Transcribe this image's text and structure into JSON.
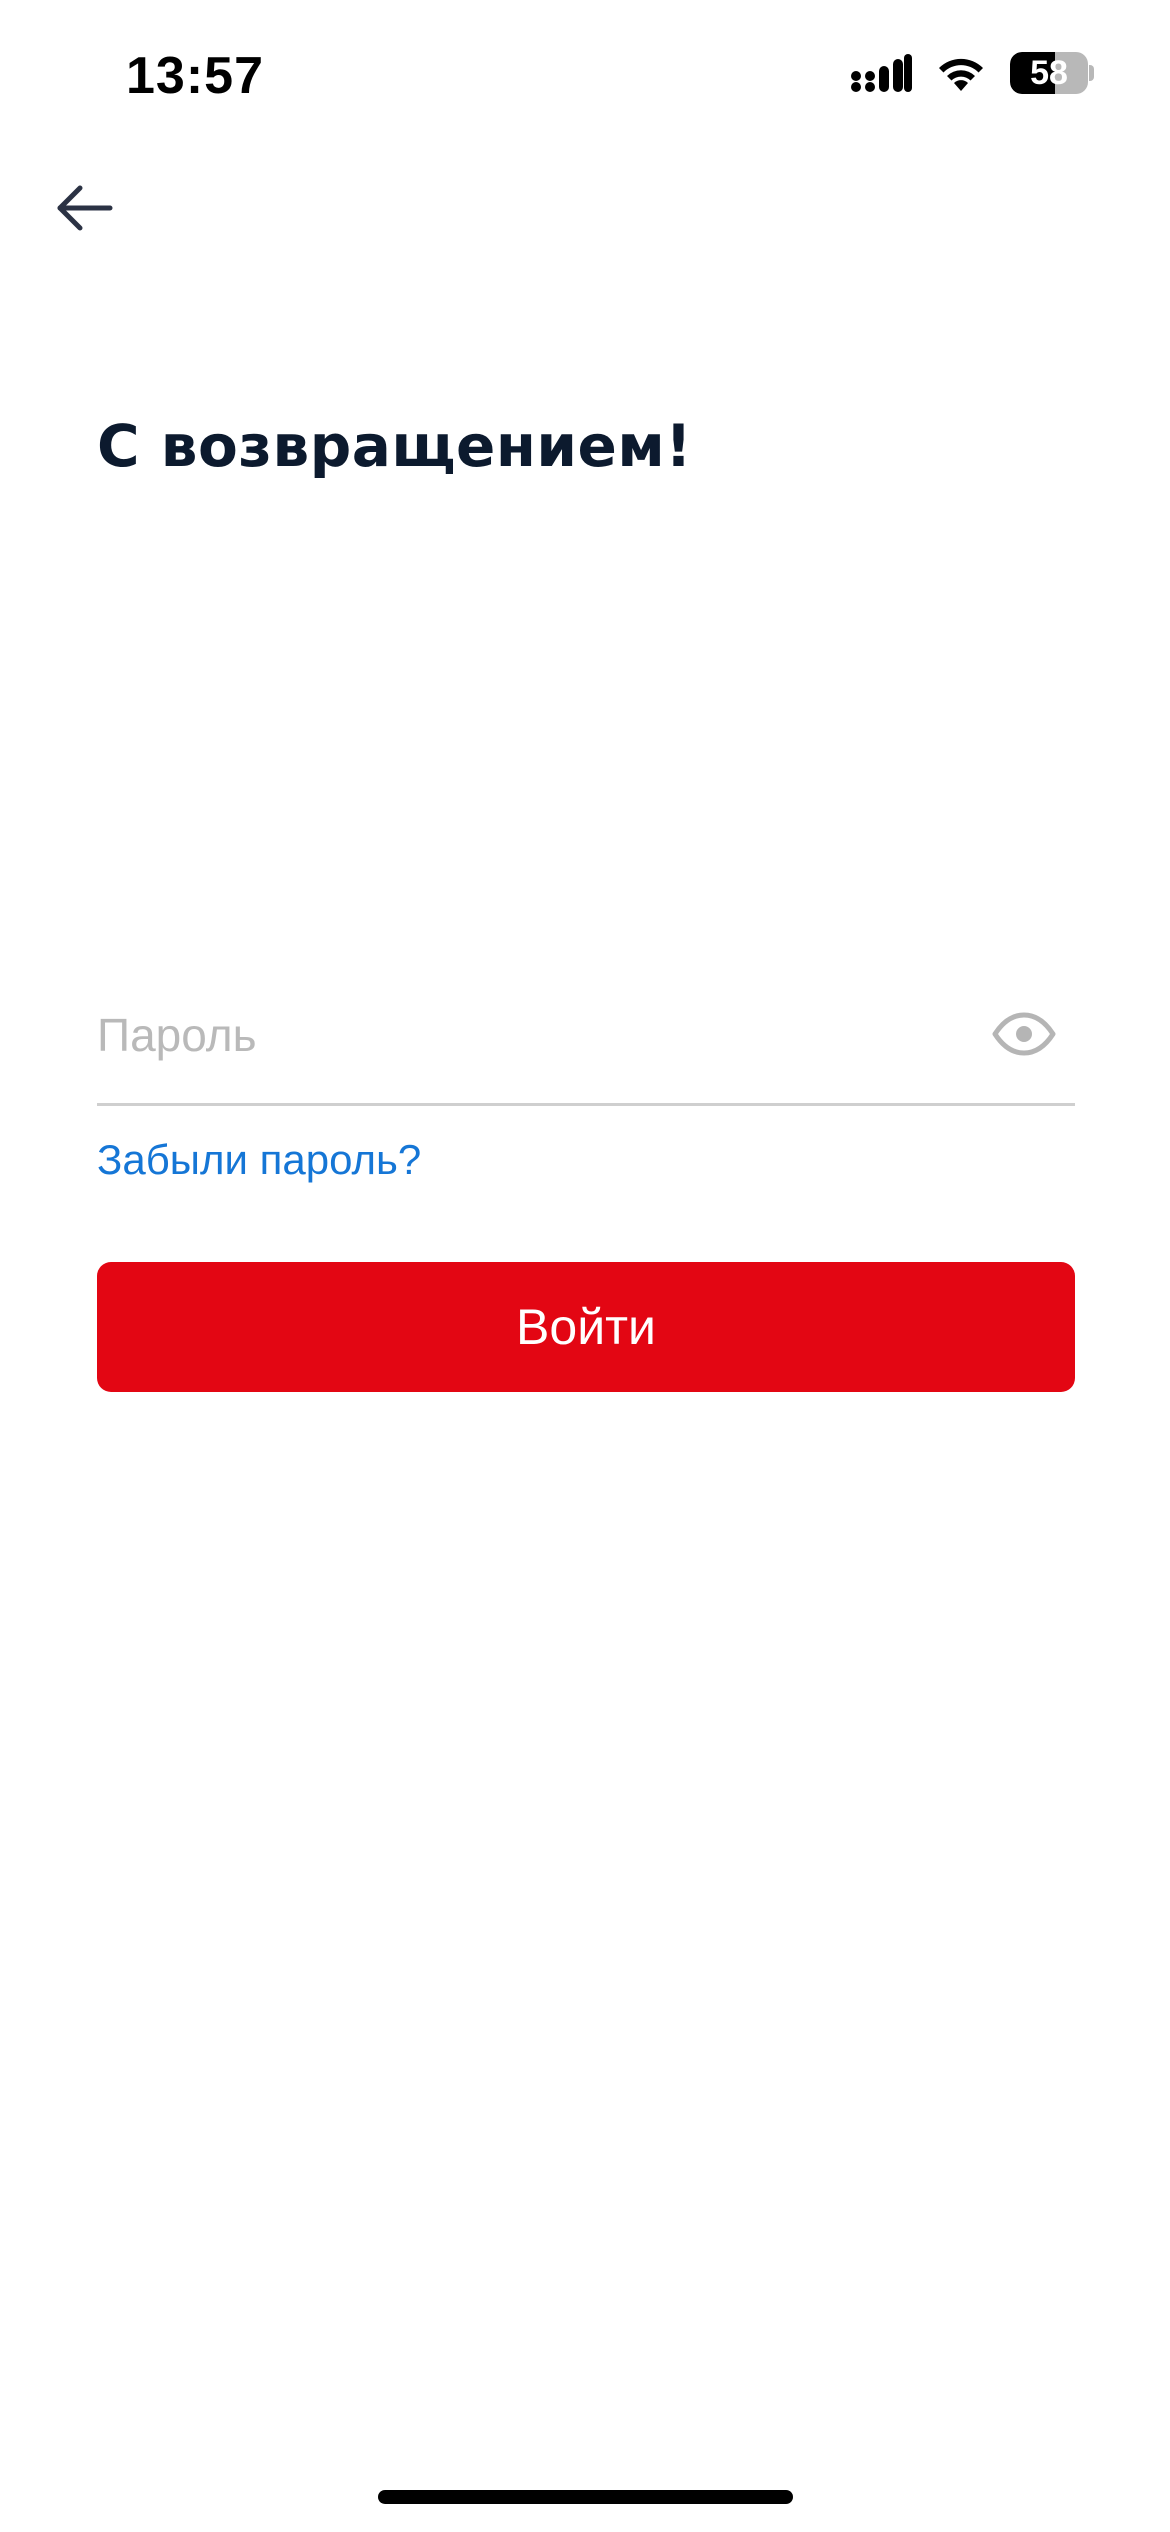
{
  "status_bar": {
    "time": "13:57",
    "battery_percent": "58",
    "battery_level": 0.58,
    "icons": [
      "signal-icon",
      "wifi-icon",
      "battery-icon"
    ]
  },
  "nav": {
    "back_icon": "arrow-left-icon"
  },
  "page": {
    "title": "С возвращением!"
  },
  "password_field": {
    "placeholder": "Пароль",
    "value": "",
    "toggle_icon": "eye-icon"
  },
  "forgot_password": {
    "label": "Забыли пароль?"
  },
  "login_button": {
    "label": "Войти"
  },
  "colors": {
    "accent_red": "#e30613",
    "link_blue": "#1576d6",
    "title_dark": "#0c1a2e",
    "placeholder_gray": "#b9b9b9",
    "divider_gray": "#cfcfcf"
  }
}
